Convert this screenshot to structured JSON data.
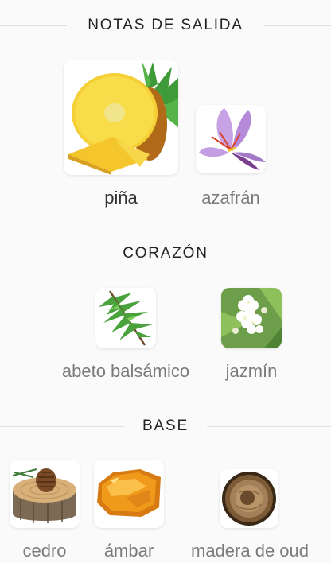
{
  "sections": [
    {
      "title": "NOTAS DE SALIDA",
      "notes": [
        {
          "label": "piña",
          "icon": "pineapple-icon",
          "emphasis": true
        },
        {
          "label": "azafrán",
          "icon": "saffron-flower-icon",
          "emphasis": false
        }
      ]
    },
    {
      "title": "CORAZÓN",
      "notes": [
        {
          "label": "abeto balsámico",
          "icon": "fir-branch-icon",
          "emphasis": false
        },
        {
          "label": "jazmín",
          "icon": "jasmine-flower-icon",
          "emphasis": false
        }
      ]
    },
    {
      "title": "BASE",
      "notes": [
        {
          "label": "cedro",
          "icon": "cedar-log-icon",
          "emphasis": false
        },
        {
          "label": "ámbar",
          "icon": "amber-stone-icon",
          "emphasis": false
        },
        {
          "label": "madera de oud",
          "icon": "oud-wood-icon",
          "emphasis": false
        }
      ]
    }
  ]
}
